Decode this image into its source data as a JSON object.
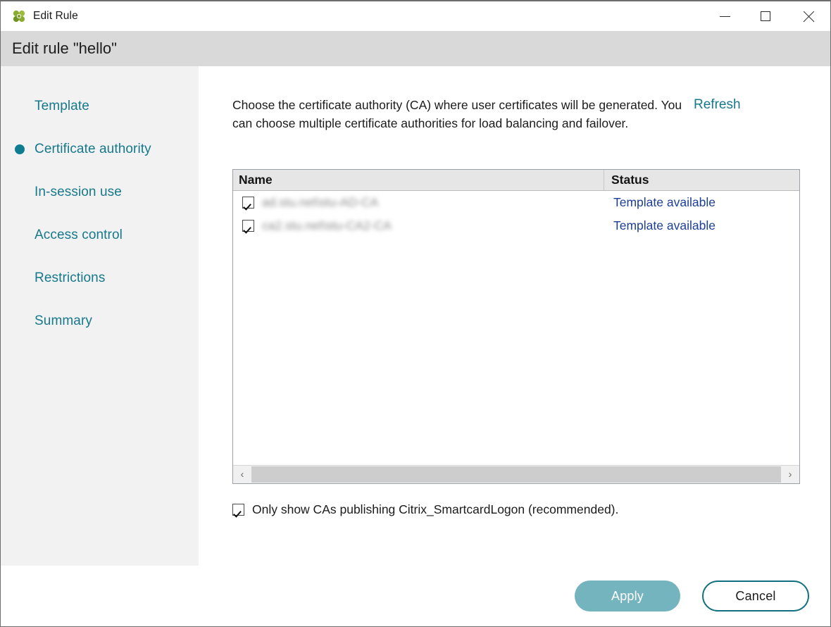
{
  "window": {
    "title": "Edit Rule",
    "app_icon": "citrix-flower-icon",
    "controls": {
      "minimize": "minimize-icon",
      "maximize": "maximize-icon",
      "close": "close-icon"
    }
  },
  "subheader": {
    "title": "Edit rule \"hello\""
  },
  "sidebar": {
    "items": [
      {
        "label": "Template",
        "active": false
      },
      {
        "label": "Certificate authority",
        "active": true
      },
      {
        "label": "In-session use",
        "active": false
      },
      {
        "label": "Access control",
        "active": false
      },
      {
        "label": "Restrictions",
        "active": false
      },
      {
        "label": "Summary",
        "active": false
      }
    ]
  },
  "main": {
    "intro": "Choose the certificate authority (CA) where user certificates will be generated. You can choose multiple certificate authorities for load balancing and failover.",
    "refresh_label": "Refresh",
    "table": {
      "columns": [
        "Name",
        "Status"
      ],
      "rows": [
        {
          "checked": true,
          "name": "ad.stu.net\\stu-AD-CA",
          "status": "Template available"
        },
        {
          "checked": true,
          "name": "ca2.stu.net\\stu-CA2-CA",
          "status": "Template available"
        }
      ],
      "scrollbar": {
        "left_arrow": "chevron-left-icon",
        "right_arrow": "chevron-right-icon"
      }
    },
    "only_show": {
      "checked": true,
      "label": "Only show CAs publishing Citrix_SmartcardLogon (recommended)."
    }
  },
  "footer": {
    "apply_label": "Apply",
    "cancel_label": "Cancel"
  },
  "colors": {
    "accent_teal": "#17788c",
    "bullet_teal": "#0f7c8f",
    "apply_fill": "#74b4bf",
    "cancel_border": "#126f80",
    "status_link": "#1c3f96",
    "sidebar_bg": "#f2f2f2",
    "subheader_bg": "#d9d9d9"
  }
}
